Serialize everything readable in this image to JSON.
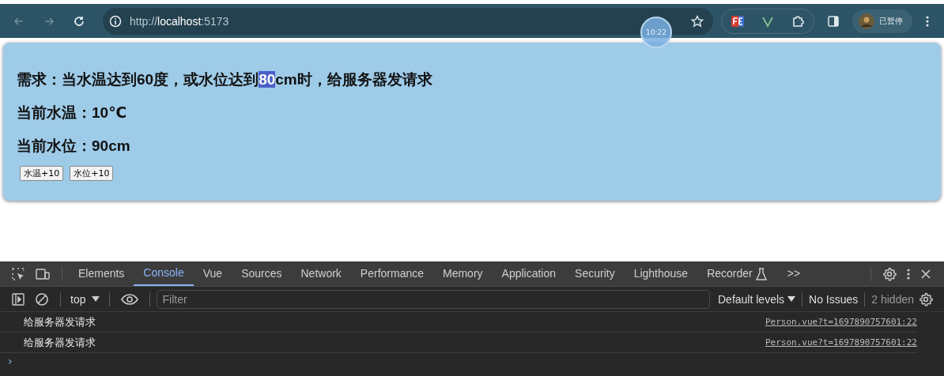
{
  "browser": {
    "url_host": "localhost",
    "url_scheme": "http://",
    "url_port": ":5173",
    "profile_status": "已暂停",
    "clock_overlay": "10:22"
  },
  "page": {
    "heading": [
      {
        "text": "需求：当水温达到60度，或水位达到",
        "selected": false
      },
      {
        "text": "80",
        "selected": true
      },
      {
        "text": "cm时，给服务器发请求",
        "selected": false
      }
    ],
    "lines": [
      "当前水温：10℃",
      "当前水位：90cm"
    ],
    "buttons": [
      "水温+10",
      "水位+10"
    ]
  },
  "devtools": {
    "tabs": [
      {
        "label": "Elements",
        "selected": false
      },
      {
        "label": "Console",
        "selected": true
      },
      {
        "label": "Vue",
        "selected": false
      },
      {
        "label": "Sources",
        "selected": false
      },
      {
        "label": "Network",
        "selected": false
      },
      {
        "label": "Performance",
        "selected": false
      },
      {
        "label": "Memory",
        "selected": false
      },
      {
        "label": "Application",
        "selected": false
      },
      {
        "label": "Security",
        "selected": false
      },
      {
        "label": "Lighthouse",
        "selected": false
      },
      {
        "label": "Recorder",
        "selected": false
      }
    ],
    "more_tabs": ">>",
    "context": "top",
    "filter_placeholder": "Filter",
    "levels": "Default levels",
    "issues": "No Issues",
    "hidden": "2 hidden",
    "messages": [
      {
        "text": "给服务器发请求",
        "source": "Person.vue?t=1697890757601:22"
      },
      {
        "text": "给服务器发请求",
        "source": "Person.vue?t=1697890757601:22"
      }
    ],
    "prompt": "›"
  }
}
